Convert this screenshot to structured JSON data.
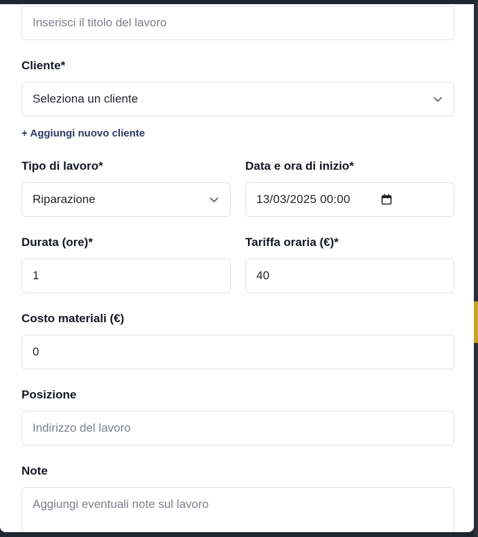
{
  "form": {
    "title_field": {
      "placeholder": "Inserisci il titolo del lavoro",
      "value": ""
    },
    "client": {
      "label": "Cliente*",
      "selected": "Seleziona un cliente",
      "add_link": "+ Aggiungi nuovo cliente"
    },
    "job_type": {
      "label": "Tipo di lavoro*",
      "selected": "Riparazione"
    },
    "start": {
      "label": "Data e ora di inizio*",
      "value": "13/03/2025 00:00"
    },
    "duration": {
      "label": "Durata (ore)*",
      "value": "1"
    },
    "hourly_rate": {
      "label": "Tariffa oraria (€)*",
      "value": "40"
    },
    "materials_cost": {
      "label": "Costo materiali (€)",
      "value": "0"
    },
    "position": {
      "label": "Posizione",
      "placeholder": "Indirizzo del lavoro",
      "value": ""
    },
    "notes": {
      "label": "Note",
      "placeholder": "Aggiungi eventuali note sul lavoro"
    }
  },
  "icons": {
    "select_chevron": "chevron-down-icon",
    "date_picker": "calendar-icon"
  },
  "colors": {
    "border": "#dfe3e8",
    "link": "#2b3a63",
    "placeholder": "#7a7f87",
    "label": "#141820"
  }
}
